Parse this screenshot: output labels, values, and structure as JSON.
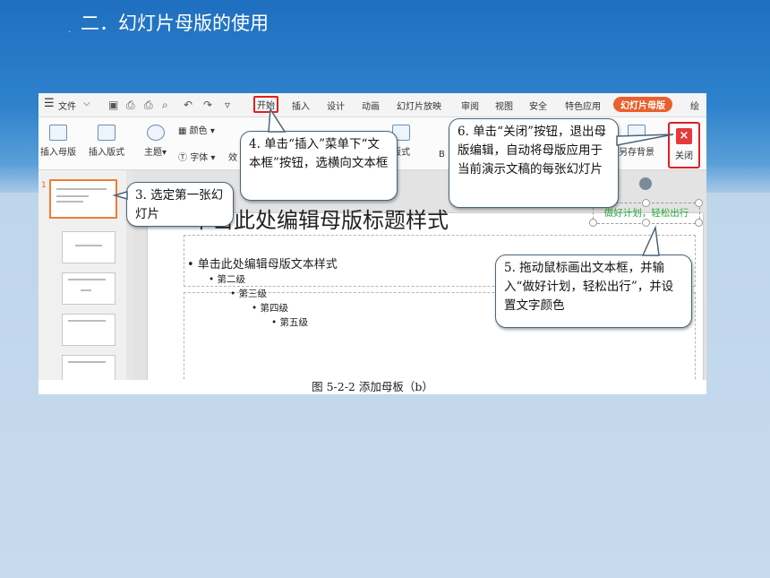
{
  "slide": {
    "title": "二．幻灯片母版的使用"
  },
  "tabs": {
    "file": "文件",
    "items": [
      "开始",
      "插入",
      "设计",
      "动画",
      "幻灯片放映",
      "审阅",
      "视图",
      "安全",
      "特色应用"
    ],
    "active": "幻灯片母版",
    "more": "绘"
  },
  "ribbon": {
    "insert_master": "插入母版",
    "insert_layout": "插入版式",
    "theme": "主题",
    "color": "颜色",
    "font": "字体",
    "effect": "效",
    "layout": "版式",
    "bg_prefix": "B",
    "save_bg": "另存背景",
    "close": "关闭",
    "close_glyph": "×"
  },
  "thumbs": {
    "selected_num": "1"
  },
  "canvas": {
    "title": "单击此处编辑母版标题样式",
    "text": "• 单击此处编辑母版文本样式",
    "levels": [
      "• 第二级",
      "• 第三级",
      "• 第四级",
      "• 第五级"
    ],
    "green_box": "做好计划，轻松出行"
  },
  "callouts": {
    "step3": "3. 选定第一张幻灯片",
    "step4": "4. 单击“插入”菜单下“文本框”按钮，选横向文本框",
    "step5": "5. 拖动鼠标画出文本框，并输入“做好计划，轻松出行”，并设置文字颜色",
    "step6": "6. 单击“关闭”按钮，退出母版编辑，自动将母版应用于当前演示文稿的每张幻灯片"
  },
  "caption": "图 5-2-2 添加母板（b）",
  "colors": {
    "banner": "#1f6fc0",
    "accent": "#e9602c",
    "highlight": "#e02020",
    "green_text": "#2faa3e"
  }
}
